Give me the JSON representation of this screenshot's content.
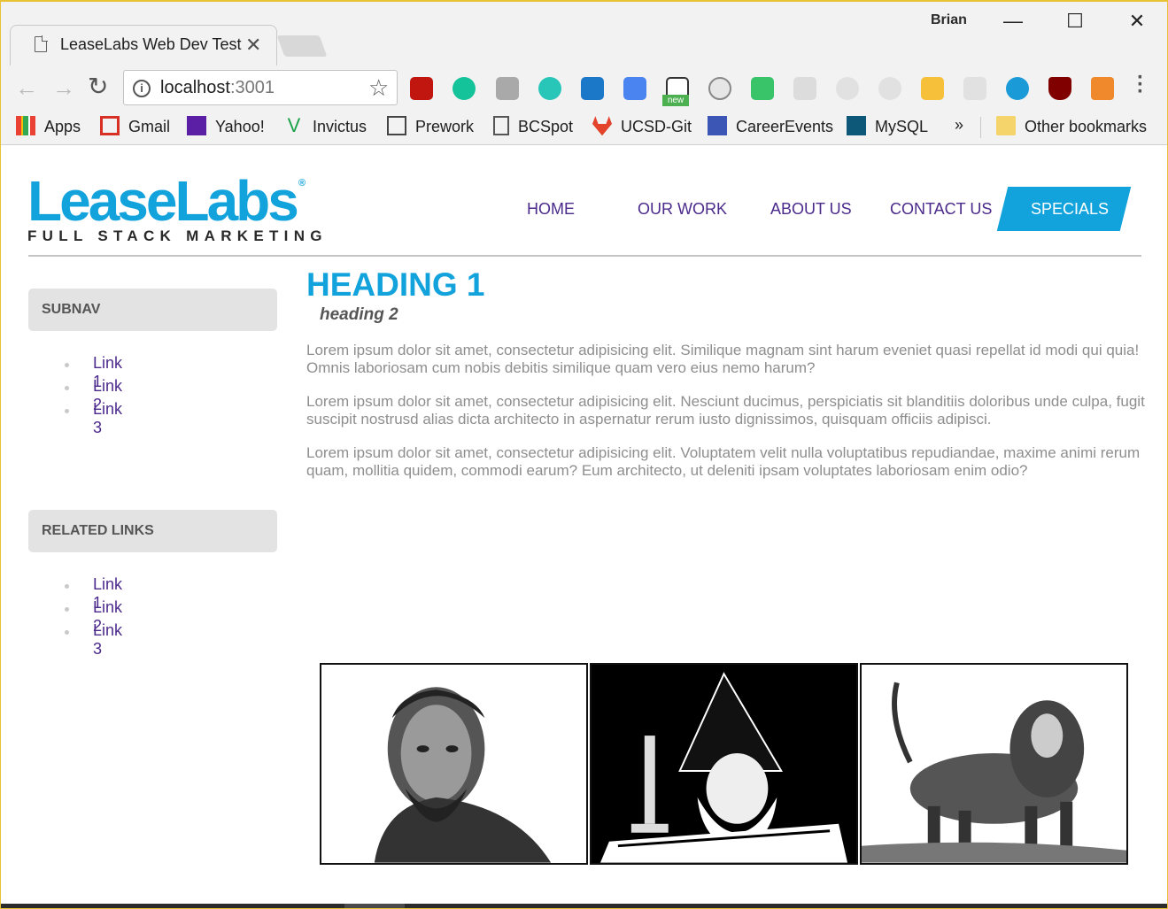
{
  "browser": {
    "tab_title": "LeaseLabs Web Dev Test",
    "user": "Brian",
    "url_host": "localhost",
    "url_port": ":3001",
    "bookmarks": [
      "Apps",
      "Gmail",
      "Yahoo!",
      "Invictus",
      "Prework",
      "BCSpot",
      "UCSD-Git",
      "CareerEvents",
      "MySQL"
    ],
    "overflow": "»",
    "other_bookmarks": "Other bookmarks",
    "ext_badge": "new"
  },
  "logo": {
    "name": "LeaseLabs",
    "reg": "®",
    "tagline": "FULL STACK MARKETING"
  },
  "nav": {
    "items": [
      "HOME",
      "OUR WORK",
      "ABOUT US",
      "CONTACT US"
    ],
    "specials": "SPECIALS"
  },
  "sidebar": {
    "subnav": {
      "title": "SUBNAV",
      "links": [
        "Link 1",
        "Link 2",
        "Link 3"
      ]
    },
    "related": {
      "title": "RELATED LINKS",
      "links": [
        "Link 1",
        "Link 2",
        "Link 3"
      ]
    }
  },
  "content": {
    "heading1": "HEADING 1",
    "heading2": "heading 2",
    "paragraphs": [
      "Lorem ipsum dolor sit amet, consectetur adipisicing elit. Similique magnam sint harum eveniet quasi repellat id modi qui quia! Omnis laboriosam cum nobis debitis similique quam vero eius nemo harum?",
      "Lorem ipsum dolor sit amet, consectetur adipisicing elit. Nesciunt ducimus, perspiciatis sit blanditiis doloribus unde culpa, fugit suscipit nostrusd alias dicta architecto in aspernatur rerum iusto dignissimos, quisquam officiis adipisci.",
      "Lorem ipsum dolor sit amet, consectetur adipisicing elit. Voluptatem velit nulla voluptatibus repudiandae, maxime animi rerum quam, mollitia quidem, commodi earum? Eum architecto, ut deleniti ipsam voluptates laboriosam enim odio?"
    ]
  },
  "colors": {
    "brand_blue": "#13a3dc",
    "link_purple": "#4b2a8c",
    "sidebar_box": "#e3e3e3",
    "body_text": "#8e8e8e"
  },
  "icons": [
    "page-icon",
    "info-icon",
    "star-icon",
    "reload-icon",
    "back-arrow-icon",
    "forward-arrow-icon",
    "menu-icon",
    "folder-icon"
  ]
}
